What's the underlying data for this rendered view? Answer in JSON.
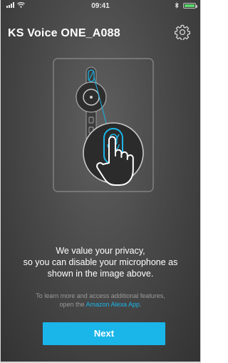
{
  "status_bar": {
    "time": "09:41",
    "battery_level": 1.0
  },
  "header": {
    "title": "KS Voice ONE_A088"
  },
  "message": {
    "line1": "We value your privacy,",
    "line2": "so you can disable your microphone as",
    "line3": "shown in the image above."
  },
  "info": {
    "line1": "To learn more and access additional features,",
    "line2_prefix": "open the ",
    "link_text": "Amazon Alexa App",
    "line2_suffix": "."
  },
  "next_button": {
    "label": "Next"
  },
  "colors": {
    "accent": "#1ab6e9",
    "background": "#4a4a4a",
    "battery": "#59d36a"
  },
  "icons": [
    "signal-icon",
    "wifi-icon",
    "bluetooth-icon",
    "battery-icon",
    "settings-gear-icon",
    "mic-mute-icon",
    "pointing-hand-icon"
  ]
}
